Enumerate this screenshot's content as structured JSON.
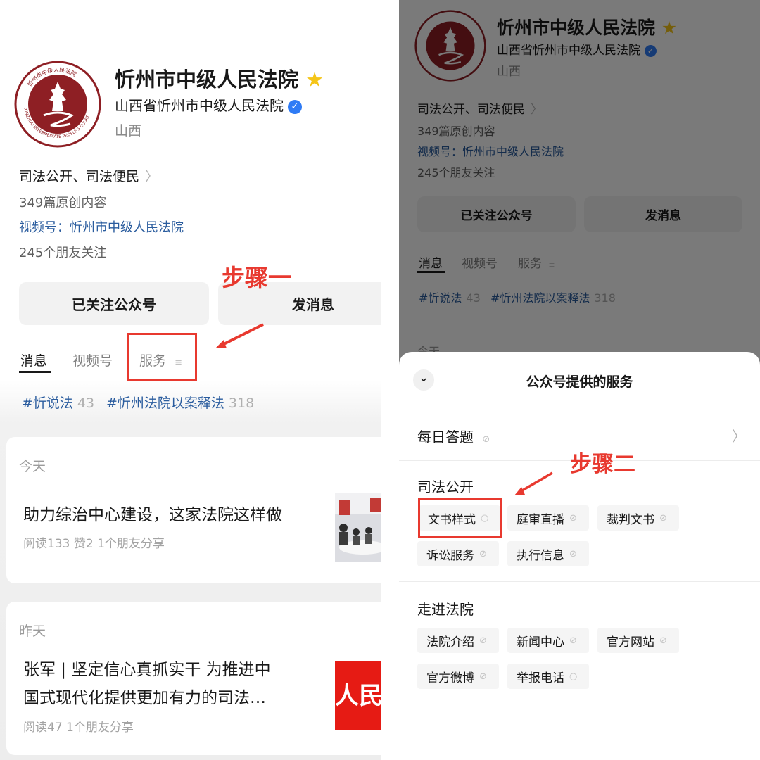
{
  "account": {
    "name": "忻州市中级人民法院",
    "star": "★",
    "subtitle": "山西省忻州市中级人民法院",
    "verified_icon": "✓",
    "region": "山西",
    "intro": "司法公开、司法便民",
    "intro_chevron": "〉",
    "original_count": "349篇原创内容",
    "channels_label": "视频号：",
    "channels_value": "忻州市中级人民法院",
    "friends_follow": "245个朋友关注",
    "seal_text": "XINZHOU INTERMEDIATE PEOPLE'S COURT",
    "seal_text_cn": "忻州市中级人民法院"
  },
  "buttons": {
    "follow": "已关注公众号",
    "message": "发消息"
  },
  "tabs": [
    {
      "label": "消息",
      "active": true
    },
    {
      "label": "视频号",
      "active": false
    },
    {
      "label": "服务",
      "active": false,
      "icon": "≡"
    }
  ],
  "hashtags": [
    {
      "label": "#忻说法",
      "count": "43"
    },
    {
      "label": "#忻州法院以案释法",
      "count": "318"
    }
  ],
  "feed": [
    {
      "day": "今天",
      "title": "助力综治中心建设，这家法院这样做",
      "meta": "阅读133  赞2  1个朋友分享"
    },
    {
      "day": "昨天",
      "title_line1": "张军 | 坚定信心真抓实干  为推进中",
      "title_line2": "国式现代化提供更加有力的司法…",
      "meta": "阅读47  1个朋友分享",
      "thumb_text": "人民司"
    }
  ],
  "annotations": {
    "step1": "步骤一",
    "step2": "步骤二"
  },
  "right_bg": {
    "peek_day": "今天"
  },
  "sheet": {
    "title": "公众号提供的服务",
    "close_icon": "⌄",
    "daily_quiz": "每日答题",
    "row_chevron": "〉",
    "link_icon": "⊘",
    "chat_icon": "○",
    "groups": [
      {
        "title": "司法公开",
        "items": [
          {
            "label": "文书样式",
            "icon": "chat"
          },
          {
            "label": "庭审直播",
            "icon": "link"
          },
          {
            "label": "裁判文书",
            "icon": "link"
          },
          {
            "label": "诉讼服务",
            "icon": "link"
          },
          {
            "label": "执行信息",
            "icon": "link"
          }
        ]
      },
      {
        "title": "走进法院",
        "items": [
          {
            "label": "法院介绍",
            "icon": "link"
          },
          {
            "label": "新闻中心",
            "icon": "link"
          },
          {
            "label": "官方网站",
            "icon": "link"
          },
          {
            "label": "官方微博",
            "icon": "link"
          },
          {
            "label": "举报电话",
            "icon": "chat"
          }
        ]
      }
    ]
  },
  "colors": {
    "accent_red": "#e8392f",
    "link_blue": "#2a5c9e",
    "verified_blue": "#2f7bf5",
    "star_gold": "#f5c518",
    "seal_red": "#8e1f24"
  }
}
